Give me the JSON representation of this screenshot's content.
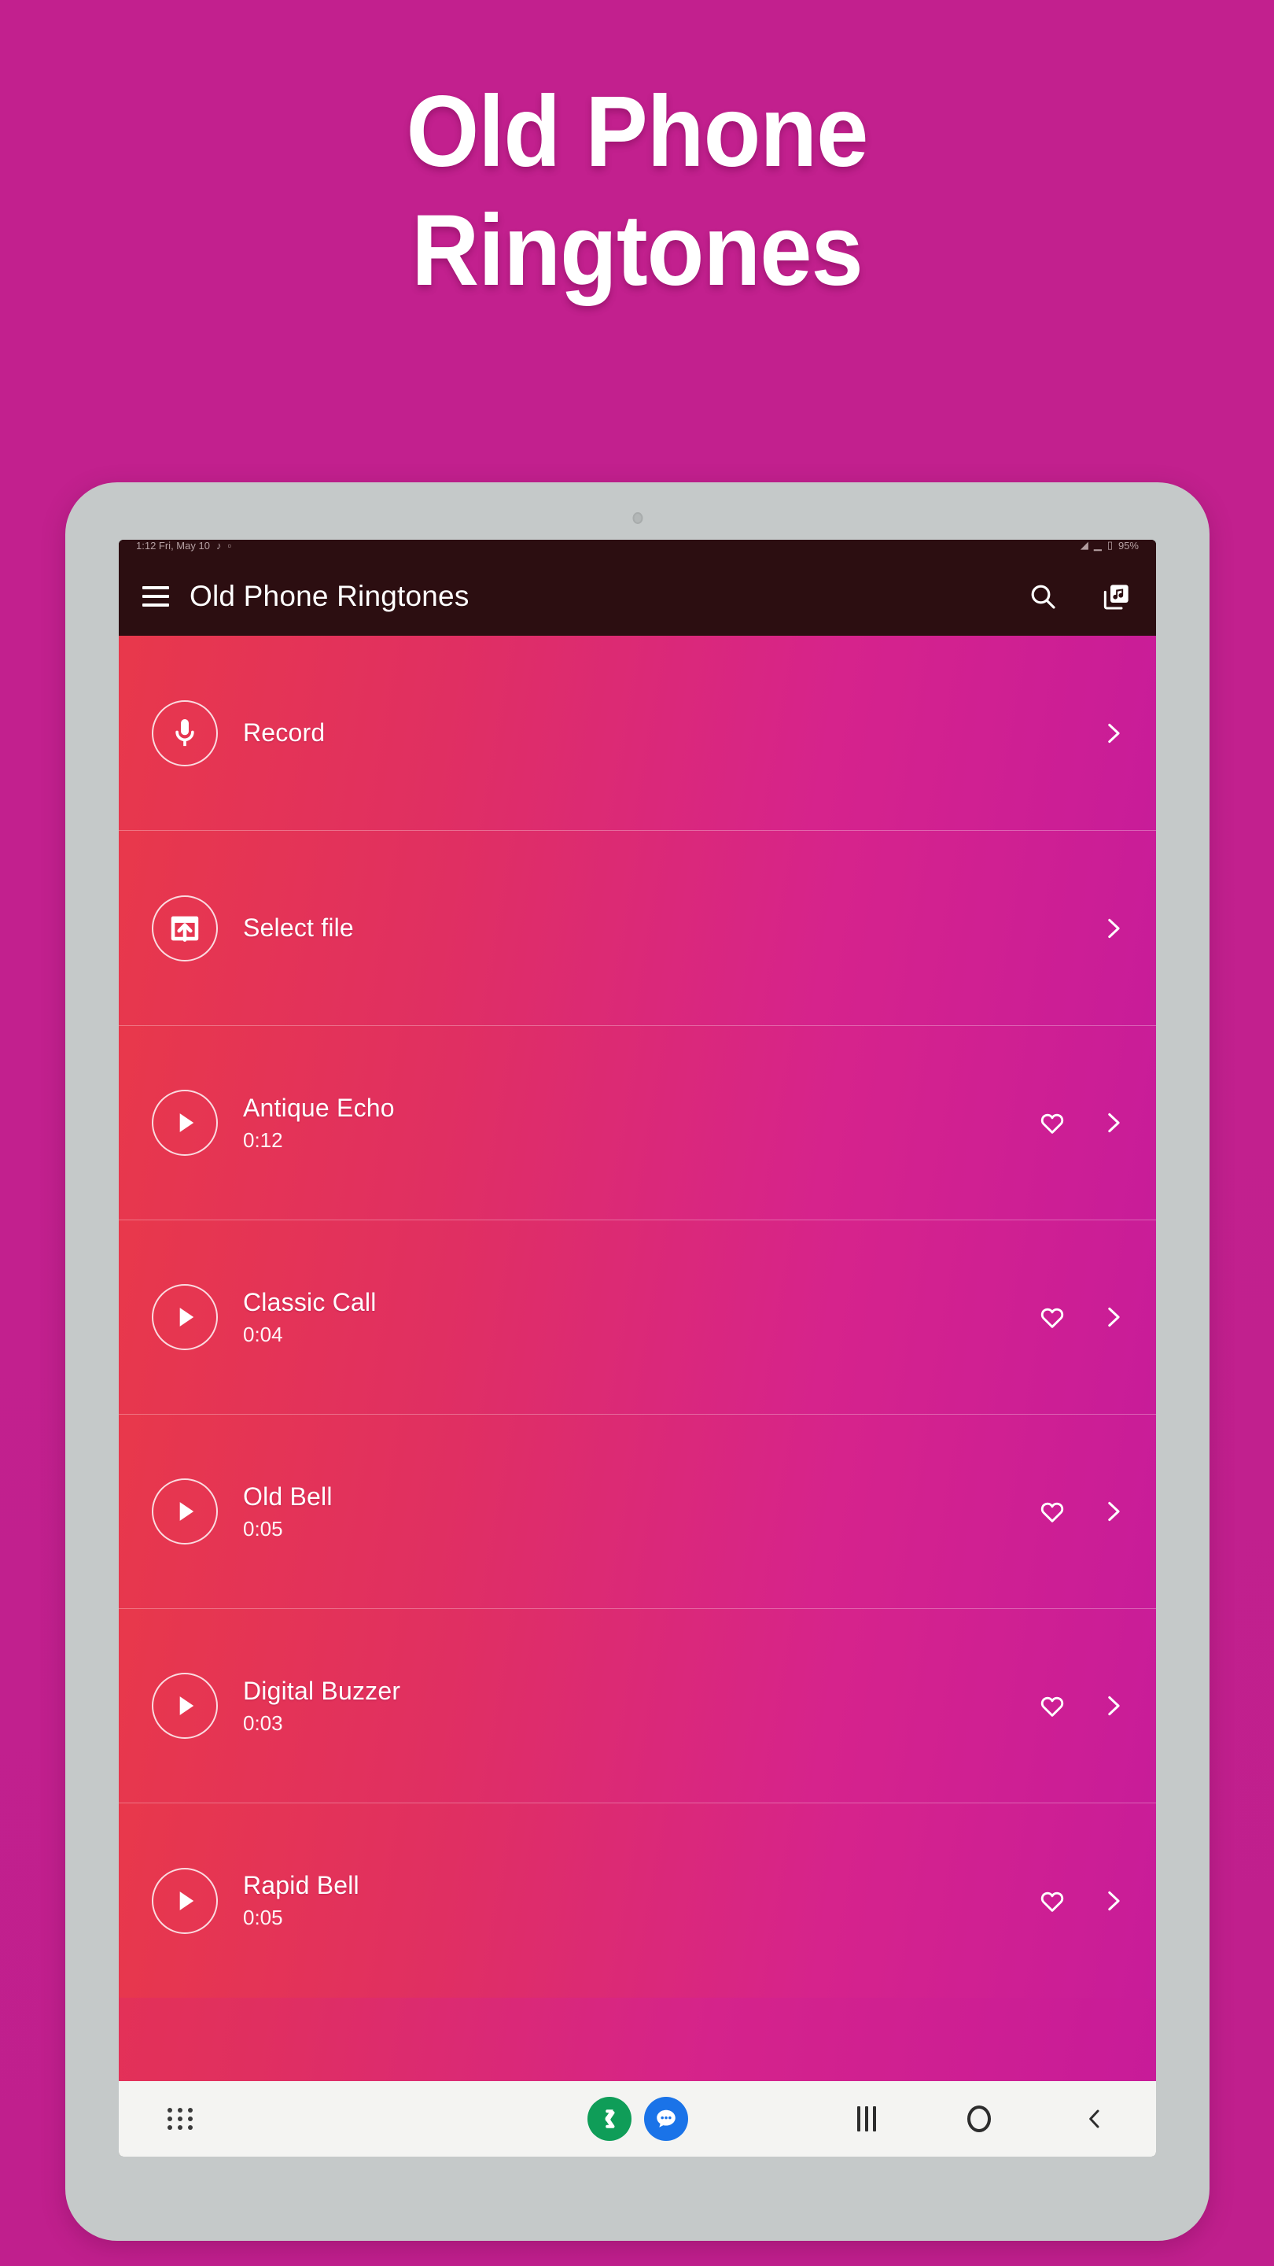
{
  "promo": {
    "title_line1": "Old Phone",
    "title_line2": "Ringtones",
    "background_color": "#c2208e"
  },
  "device": {
    "frame_color": "#c5c9c9",
    "camera": "front-camera-dot"
  },
  "status_bar": {
    "background_color": "#2c0e11",
    "left_text": "1:12 Fri, May 10",
    "icons_left": [
      "sound-icon",
      "notification-icon"
    ],
    "icons_right": [
      "wifi-icon",
      "signal-icon",
      "battery-icon"
    ],
    "right_text": "95%"
  },
  "app_bar": {
    "menu_icon": "hamburger-menu-icon",
    "title": "Old Phone Ringtones",
    "search_icon": "search-icon",
    "library_icon": "music-library-icon",
    "background_color": "#2c0e11",
    "text_color": "#ffffff"
  },
  "list": {
    "gradient_from": "#e8384b",
    "gradient_to": "#c81c99",
    "actions": [
      {
        "icon": "microphone-icon",
        "label": "Record",
        "chevron": "chevron-right-icon"
      },
      {
        "icon": "import-file-icon",
        "label": "Select file",
        "chevron": "chevron-right-icon"
      }
    ],
    "ringtones": [
      {
        "icon": "play-icon",
        "title": "Antique Echo",
        "duration": "0:12",
        "favorite_icon": "heart-outline-icon",
        "favorited": false,
        "chevron": "chevron-right-icon"
      },
      {
        "icon": "play-icon",
        "title": "Classic Call",
        "duration": "0:04",
        "favorite_icon": "heart-outline-icon",
        "favorited": false,
        "chevron": "chevron-right-icon"
      },
      {
        "icon": "play-icon",
        "title": "Old Bell",
        "duration": "0:05",
        "favorite_icon": "heart-outline-icon",
        "favorited": false,
        "chevron": "chevron-right-icon"
      },
      {
        "icon": "play-icon",
        "title": "Digital Buzzer",
        "duration": "0:03",
        "favorite_icon": "heart-outline-icon",
        "favorited": false,
        "chevron": "chevron-right-icon"
      },
      {
        "icon": "play-icon",
        "title": "Rapid Bell",
        "duration": "0:05",
        "favorite_icon": "heart-outline-icon",
        "favorited": false,
        "chevron": "chevron-right-icon"
      }
    ]
  },
  "nav_bar": {
    "background_color": "#f4f4f2",
    "apps_icon": "app-grid-icon",
    "shortcuts": [
      {
        "icon": "phone-icon",
        "color": "#0f9d58"
      },
      {
        "icon": "messages-icon",
        "color": "#1a73e8"
      }
    ],
    "system_buttons": [
      {
        "icon": "recents-icon"
      },
      {
        "icon": "home-icon"
      },
      {
        "icon": "back-icon"
      }
    ]
  }
}
